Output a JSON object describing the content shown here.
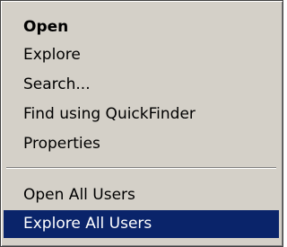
{
  "context_menu": {
    "items": [
      {
        "label": "Open"
      },
      {
        "label": "Explore"
      },
      {
        "label": "Search..."
      },
      {
        "label": "Find using QuickFinder"
      },
      {
        "label": "Properties"
      },
      {
        "label": "Open All Users"
      },
      {
        "label": "Explore All Users"
      }
    ],
    "default_item": "Open",
    "highlighted_item": "Explore All Users"
  },
  "colors": {
    "menu_background": "#d4d0c8",
    "highlight_background": "#0a246a",
    "highlight_text": "#ffffff",
    "text": "#000000"
  }
}
